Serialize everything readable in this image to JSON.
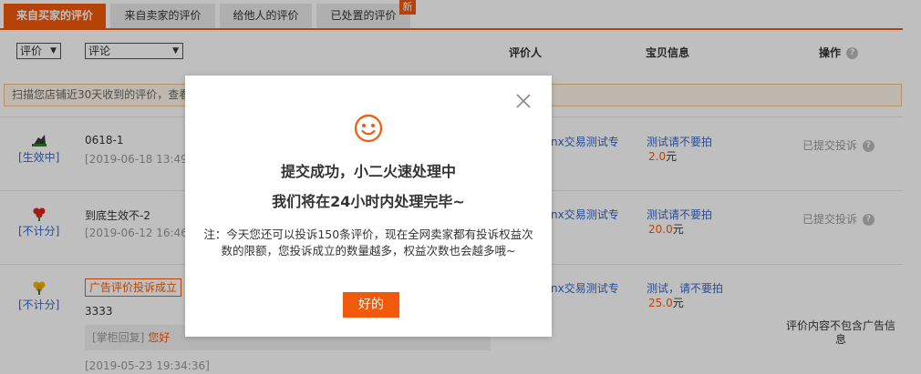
{
  "tabs": [
    {
      "label": "来自买家的评价",
      "active": true
    },
    {
      "label": "来自卖家的评价",
      "active": false
    },
    {
      "label": "给他人的评价",
      "active": false
    },
    {
      "label": "已处置的评价",
      "active": false
    }
  ],
  "tab_new_badge": "新",
  "filters": {
    "rating_select": "评价",
    "comment_select": "评论"
  },
  "columns": {
    "reviewer": "评价人",
    "item_info": "宝贝信息",
    "action": "操作"
  },
  "help_icon_text": "?",
  "notice_text": "扫描您店铺近30天收到的评价，查看",
  "rows": [
    {
      "status": "[生效中]",
      "status_icon": "tree-icon",
      "title": "0618-1",
      "date": "[2019-06-18 13:49:",
      "reviewer": "nx交易测试专",
      "item": "测试请不要拍",
      "price": "2.0",
      "price_unit": "元",
      "action": "已提交投诉"
    },
    {
      "status": "[不计分]",
      "status_icon": "red-flower-icon",
      "title": "到底生效不-2",
      "date": "[2019-06-12 16:46:",
      "reviewer": "nx交易测试专",
      "item": "测试请不要拍",
      "price": "20.0",
      "price_unit": "元",
      "action": "已提交投诉"
    },
    {
      "status": "[不计分]",
      "status_icon": "yellow-flower-icon",
      "ad_tag": "广告评价投诉成立",
      "title": "3333",
      "reply_label": "[掌柜回复]",
      "reply_text": "您好",
      "date": "[2019-05-23 19:34:36]",
      "reviewer": "nx交易测试专",
      "item": "测试，请不要拍",
      "price": "25.0",
      "price_unit": "元",
      "action": "评价内容不包含广告信息"
    }
  ],
  "modal": {
    "icon": "smiley-icon",
    "title_line1": "提交成功，小二火速处理中",
    "title_line2": "我们将在24小时内处理完毕~",
    "note": "注：今天您还可以投诉150条评价，现在全网卖家都有投诉权益次数的限额，您投诉成立的数量越多，权益次数也会越多哦~",
    "ok_label": "好的",
    "close_icon": "close-icon"
  },
  "colors": {
    "accent": "#f25a0b",
    "link": "#3366cc",
    "notice_bg": "#fef6e9"
  }
}
